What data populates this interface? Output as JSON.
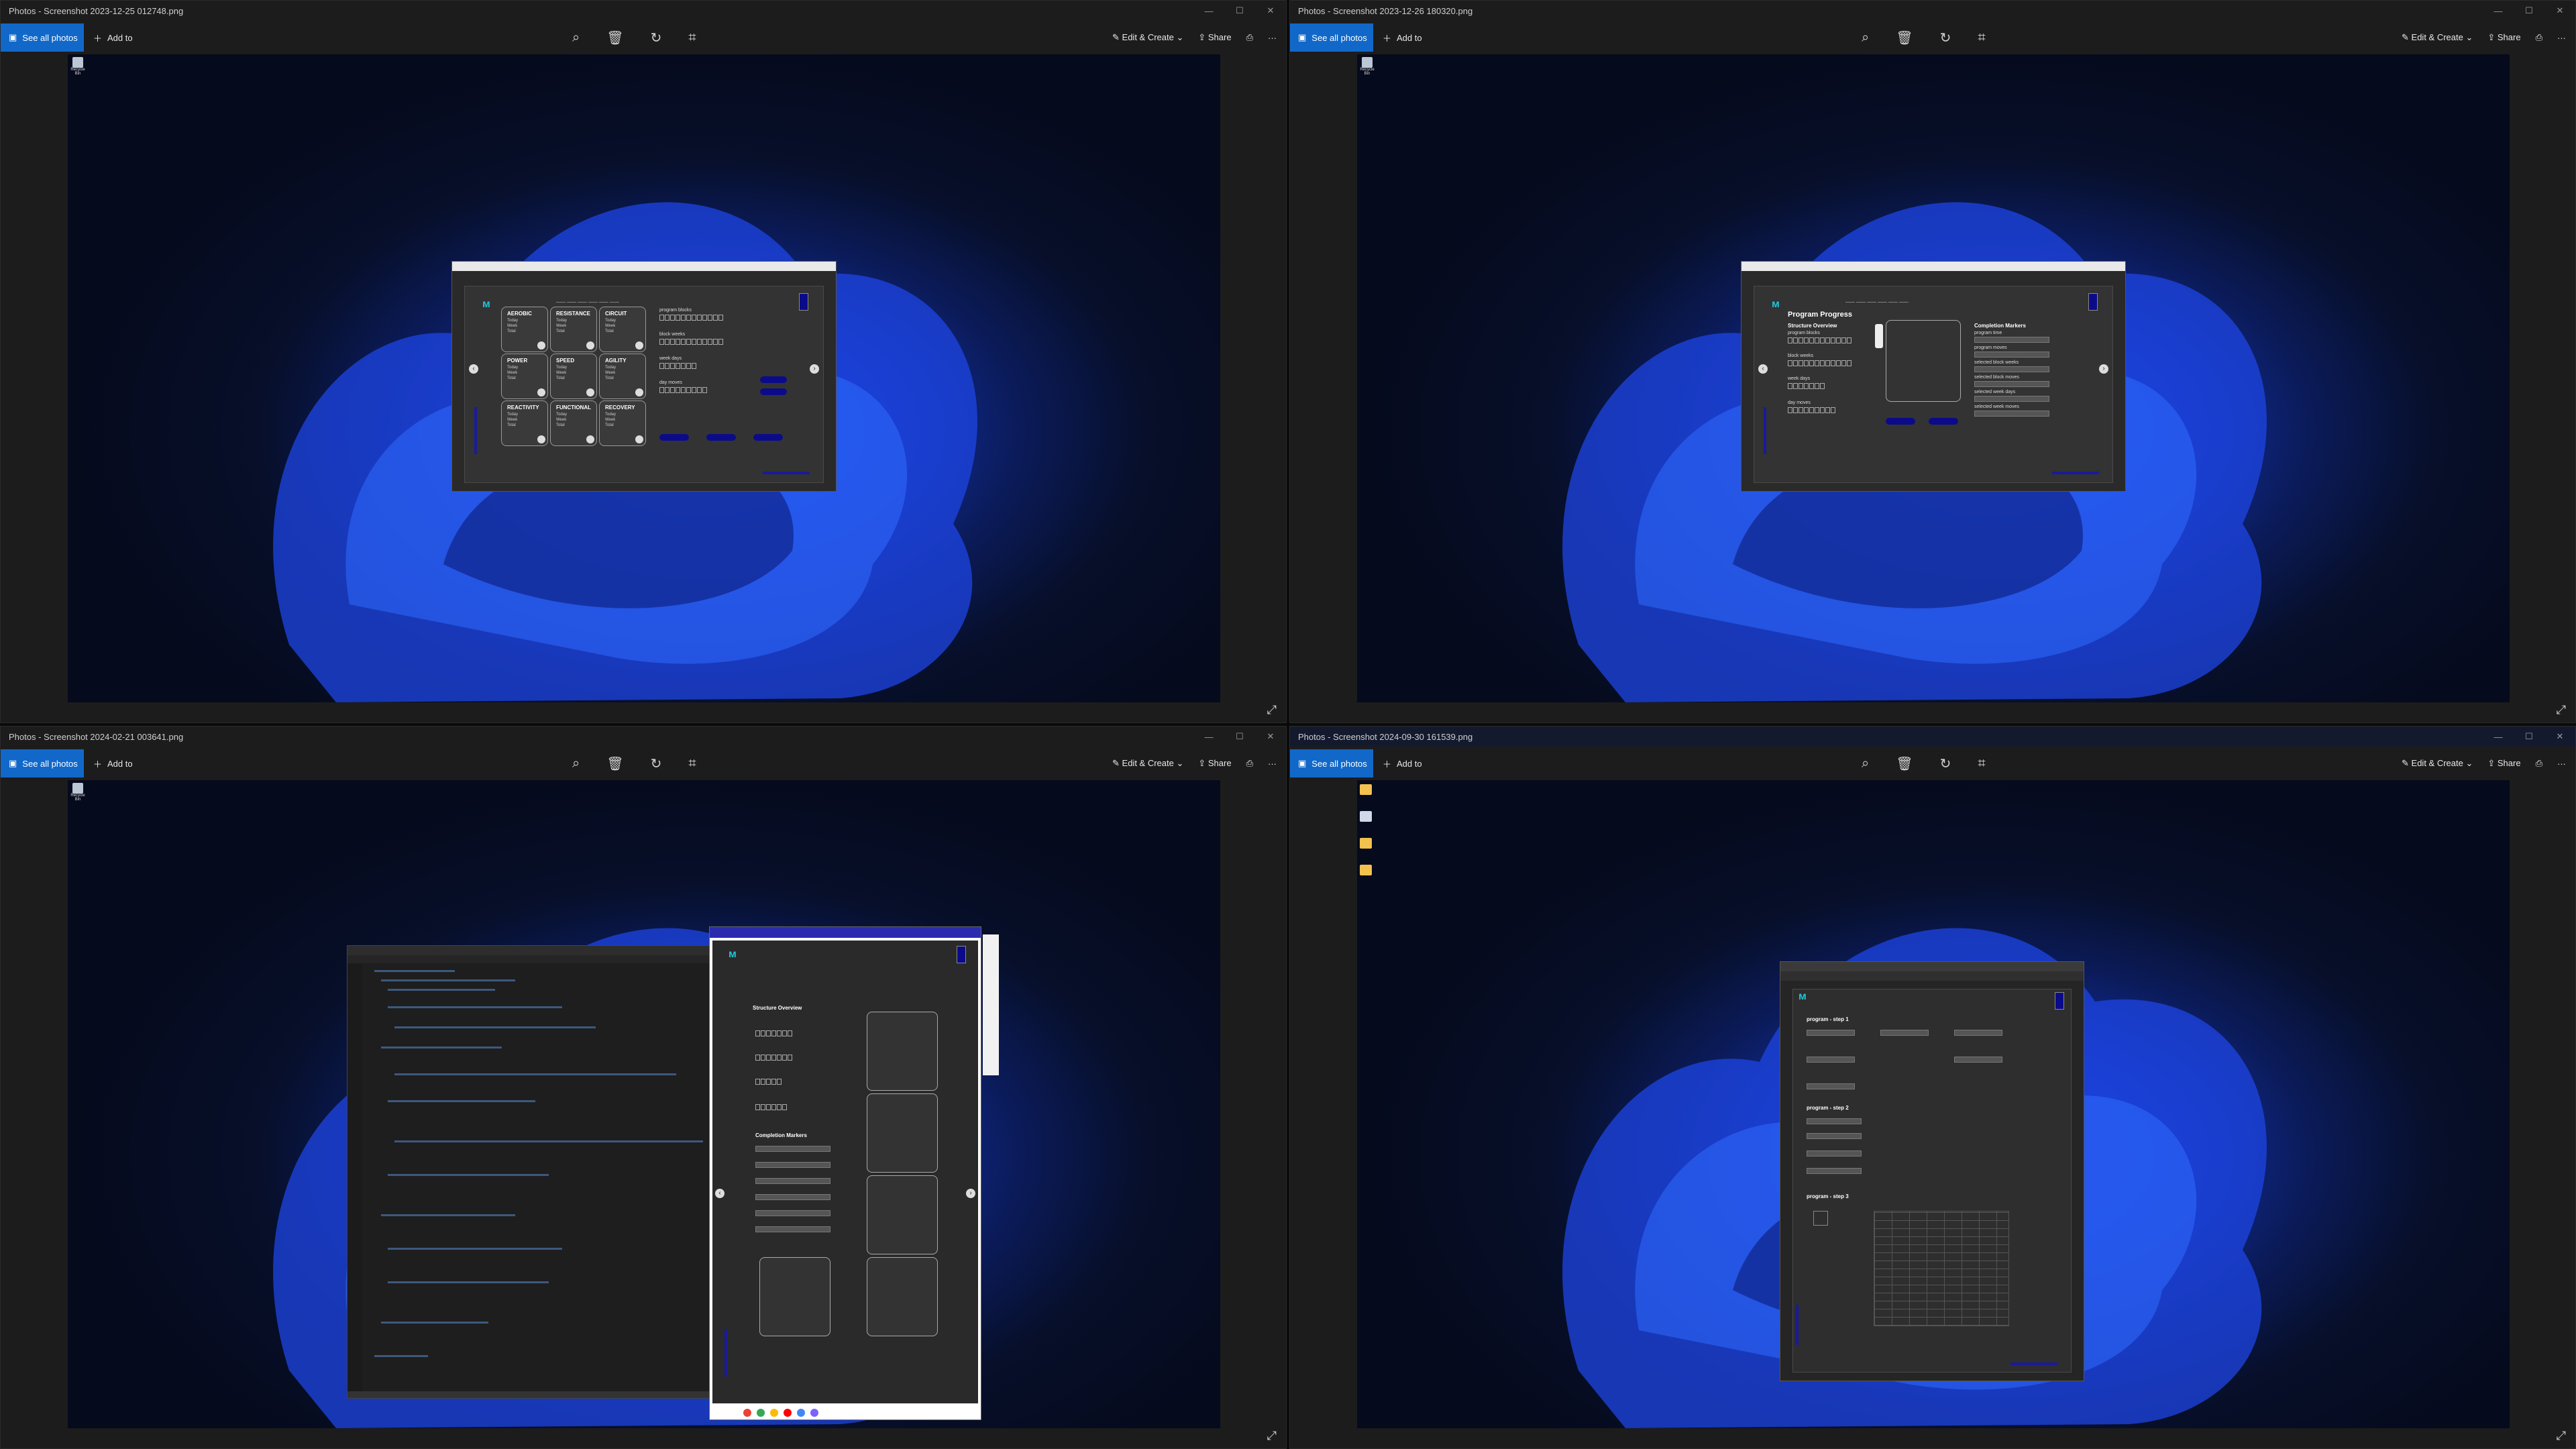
{
  "photos_app": {
    "see_all": "See all photos",
    "add_to": "Add to",
    "edit_create": "Edit & Create",
    "share": "Share",
    "more": "···",
    "window_controls": [
      "—",
      "☐",
      "✕"
    ]
  },
  "windows": [
    {
      "title": "Photos - Screenshot 2023-12-25 012748.png"
    },
    {
      "title": "Photos - Screenshot 2023-12-26 180320.png"
    },
    {
      "title": "Photos - Screenshot 2024-02-21 003641.png"
    },
    {
      "title": "Photos - Screenshot 2024-09-30 161539.png"
    }
  ],
  "desktop": {
    "recycle_bin": "Recycle Bin"
  },
  "shot1": {
    "cards": [
      {
        "title": "AEROBIC",
        "lines": [
          "Today",
          "Week",
          "Total"
        ]
      },
      {
        "title": "RESISTANCE",
        "lines": [
          "Today",
          "Week",
          "Total"
        ]
      },
      {
        "title": "CIRCUIT",
        "lines": [
          "Today",
          "Week",
          "Total"
        ]
      },
      {
        "title": "POWER",
        "lines": [
          "Today",
          "Week",
          "Total"
        ]
      },
      {
        "title": "SPEED",
        "lines": [
          "Today",
          "Week",
          "Total"
        ]
      },
      {
        "title": "AGILITY",
        "lines": [
          "Today",
          "Week",
          "Total"
        ]
      },
      {
        "title": "REACTIVITY",
        "lines": [
          "Today",
          "Week",
          "Total"
        ]
      },
      {
        "title": "FUNCTIONAL",
        "lines": [
          "Today",
          "Week",
          "Total"
        ]
      },
      {
        "title": "RECOVERY",
        "lines": [
          "Today",
          "Week",
          "Total"
        ]
      }
    ],
    "rows": [
      "program blocks",
      "block weeks",
      "week days",
      "day moves"
    ]
  },
  "shot2": {
    "heading": "Program Progress",
    "structure": "Structure Overview",
    "rows": [
      "program blocks",
      "block weeks",
      "week days",
      "day moves"
    ],
    "completion": "Completion Markers",
    "markers": [
      "program time",
      "program moves",
      "selected block weeks",
      "selected block moves",
      "selected week days",
      "selected week moves"
    ]
  },
  "shot3": {
    "structure": "Structure Overview",
    "completion": "Completion Markers"
  },
  "shot4": {
    "step1": "program - step 1",
    "step2": "program - step 2",
    "step3": "program - step 3"
  }
}
